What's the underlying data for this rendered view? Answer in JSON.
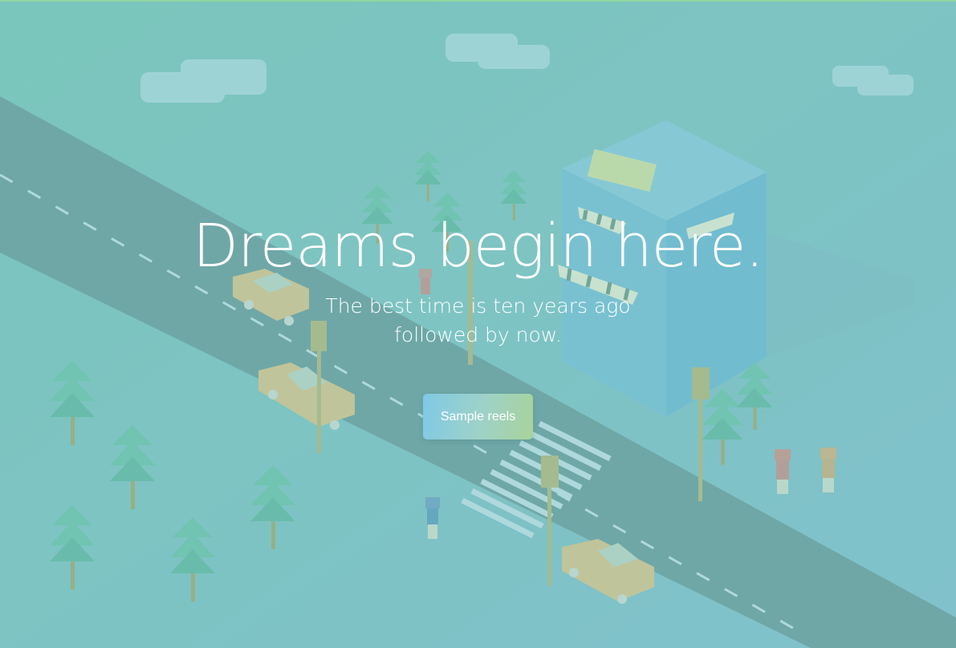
{
  "hero": {
    "title": "Dreams begin here.",
    "subtitle_line1": "The best time is ten years ago",
    "subtitle_line2": "followed by now."
  },
  "cta": {
    "label": "Sample reels"
  },
  "colors": {
    "background": "#7fc4c0",
    "road": "#6b9a9c",
    "building": "#6fb9d8",
    "tree": "#6cc4ac",
    "car": "#e2c48a",
    "text": "#ffffff",
    "button_gradient_start": "#7fc9e6",
    "button_gradient_end": "#a8d39a"
  }
}
